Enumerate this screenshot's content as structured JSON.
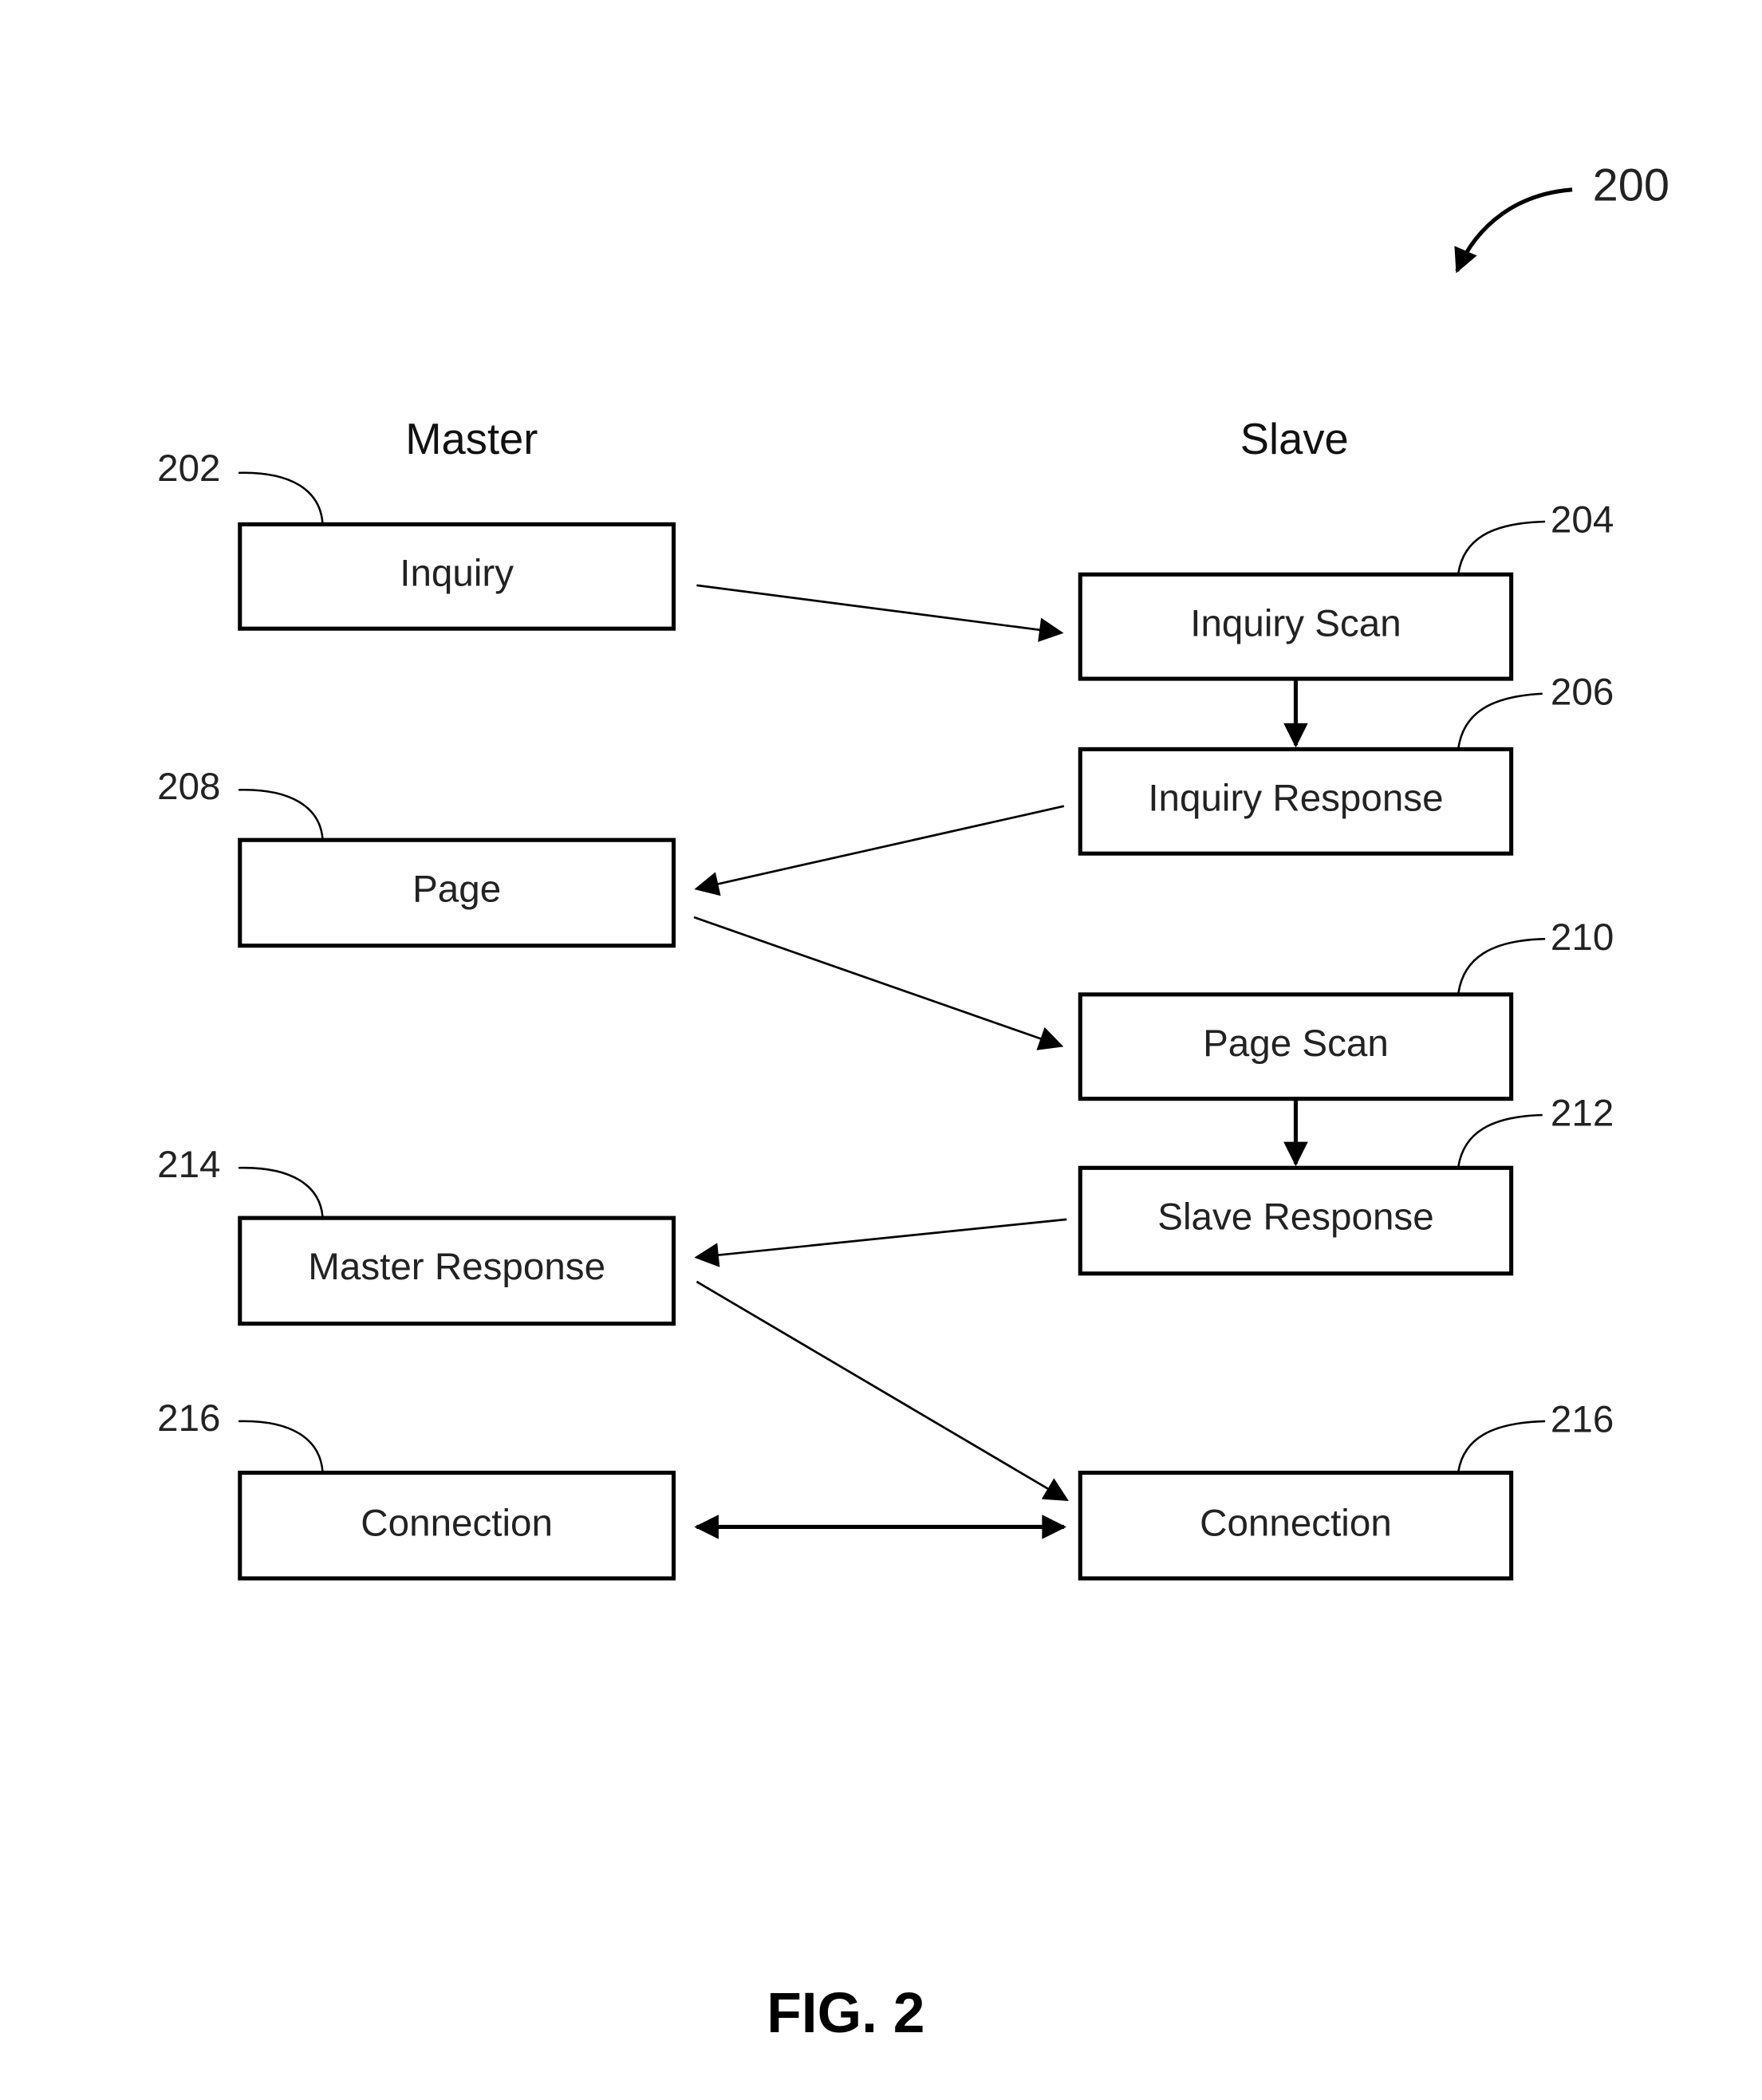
{
  "figure": {
    "number_label": "200",
    "caption": "FIG. 2"
  },
  "columns": {
    "master": "Master",
    "slave": "Slave"
  },
  "nodes": {
    "inquiry": {
      "label": "Inquiry",
      "ref": "202"
    },
    "inquiry_scan": {
      "label": "Inquiry Scan",
      "ref": "204"
    },
    "inquiry_response": {
      "label": "Inquiry Response",
      "ref": "206"
    },
    "page": {
      "label": "Page",
      "ref": "208"
    },
    "page_scan": {
      "label": "Page Scan",
      "ref": "210"
    },
    "slave_response": {
      "label": "Slave Response",
      "ref": "212"
    },
    "master_response": {
      "label": "Master Response",
      "ref": "214"
    },
    "master_connection": {
      "label": "Connection",
      "ref": "216"
    },
    "slave_connection": {
      "label": "Connection",
      "ref": "216"
    }
  },
  "edges": [
    {
      "from": "Inquiry",
      "to": "Inquiry Scan",
      "direction": "one-way"
    },
    {
      "from": "Inquiry Scan",
      "to": "Inquiry Response",
      "direction": "one-way"
    },
    {
      "from": "Inquiry Response",
      "to": "Page",
      "direction": "one-way"
    },
    {
      "from": "Page",
      "to": "Page Scan",
      "direction": "one-way"
    },
    {
      "from": "Page Scan",
      "to": "Slave Response",
      "direction": "one-way"
    },
    {
      "from": "Slave Response",
      "to": "Master Response",
      "direction": "one-way"
    },
    {
      "from": "Master Response",
      "to": "Connection (Slave)",
      "direction": "one-way"
    },
    {
      "from": "Connection (Master)",
      "to": "Connection (Slave)",
      "direction": "two-way"
    }
  ]
}
